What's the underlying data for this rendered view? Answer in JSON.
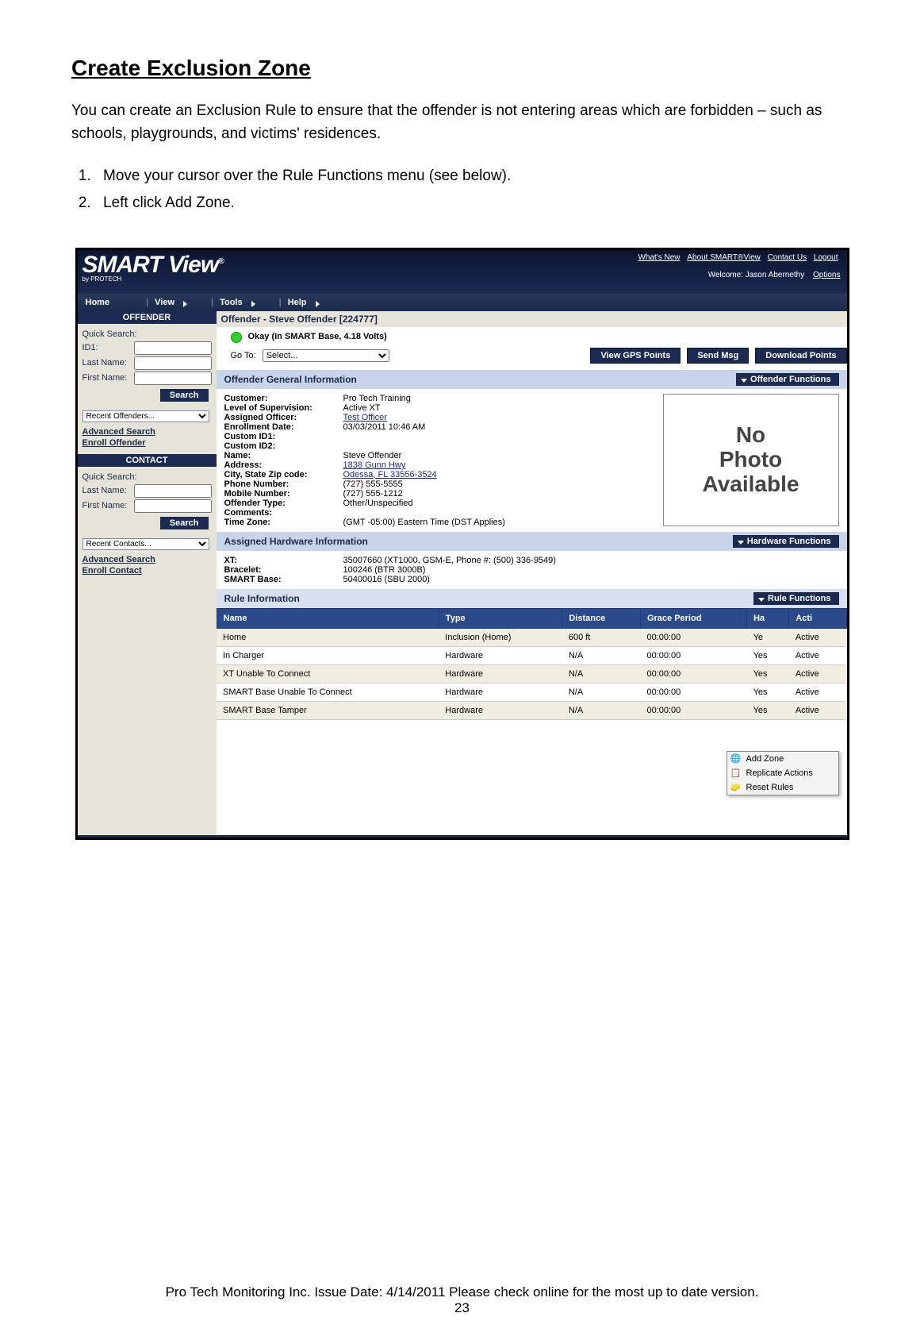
{
  "doc": {
    "heading": "Create Exclusion Zone",
    "intro": "You can create an Exclusion Rule to ensure that the offender is not entering areas which are forbidden – such as schools, playgrounds, and victims' residences.",
    "steps": [
      "Move your cursor over the Rule Functions menu (see below).",
      "Left click Add Zone."
    ],
    "footer_line1": "Pro Tech Monitoring Inc. Issue Date: 4/14/2011 Please check online for the most up to date version.",
    "footer_line2": "23"
  },
  "app": {
    "logo_main": "SMART View",
    "logo_sub": "by PROTECH",
    "toplinks": {
      "whats_new": "What's New",
      "about": "About SMART®View",
      "contact": "Contact Us",
      "logout": "Logout"
    },
    "welcome_prefix": "Welcome: ",
    "welcome_user": "Jason Abernethy",
    "options": "Options",
    "menu": {
      "home": "Home",
      "view": "View",
      "tools": "Tools",
      "help": "Help"
    }
  },
  "sidebar": {
    "offender_hdr": "OFFENDER",
    "quick_search": "Quick Search:",
    "id1": "ID1:",
    "last": "Last Name:",
    "first": "First Name:",
    "search_btn": "Search",
    "recent_off": "Recent Offenders...",
    "adv_search": "Advanced Search",
    "enroll_off": "Enroll Offender",
    "contact_hdr": "CONTACT",
    "recent_con": "Recent Contacts...",
    "enroll_con": "Enroll Contact"
  },
  "main": {
    "crumb": "Offender - Steve Offender [224777]",
    "status": "Okay (In SMART Base, 4.18 Volts)",
    "goto_label": "Go To:",
    "goto_value": "Select...",
    "btn_gps": "View GPS Points",
    "btn_msg": "Send Msg",
    "btn_dl": "Download Points",
    "sec_general": "Offender General Information",
    "fx_offender": "Offender Functions",
    "gen": {
      "labels": [
        "Customer:",
        "Level of Supervision:",
        "Assigned Officer:",
        "Enrollment Date:",
        "Custom ID1:",
        "Custom ID2:",
        "Name:",
        "Address:",
        "City, State Zip code:",
        "Phone Number:",
        "Mobile Number:",
        "Offender Type:",
        "Comments:",
        "Time Zone:"
      ],
      "values": [
        "Pro Tech Training",
        "Active XT",
        "Test Officer",
        "03/03/2011 10:46 AM",
        "",
        "",
        "Steve Offender",
        "1838 Gunn Hwy",
        "Odessa, FL 33556-3524",
        "(727) 555-5555",
        "(727) 555-1212",
        "Other/Unspecified",
        "",
        "(GMT -05:00) Eastern Time (DST Applies)"
      ]
    },
    "photo": "No\nPhoto\nAvailable",
    "sec_hw": "Assigned Hardware Information",
    "fx_hw": "Hardware Functions",
    "hw": {
      "labels": [
        "XT:",
        "Bracelet:",
        "SMART Base:"
      ],
      "values": [
        "35007660 (XT1000, GSM-E, Phone #: (500) 336-9549)",
        "100246 (BTR 3000B)",
        "50400016 (SBU 2000)"
      ]
    },
    "sec_rules": "Rule Information",
    "fx_rules": "Rule Functions",
    "rule_cols": {
      "name": "Name",
      "type": "Type",
      "dist": "Distance",
      "grace": "Grace Period",
      "hard": "Ha",
      "status": "Acti"
    },
    "rules": [
      {
        "name": "Home",
        "type": "Inclusion (Home)",
        "dist": "600 ft",
        "grace": "00:00:00",
        "hard": "Ye",
        "status": "Active"
      },
      {
        "name": "In Charger",
        "type": "Hardware",
        "dist": "N/A",
        "grace": "00:00:00",
        "hard": "Yes",
        "status": "Active"
      },
      {
        "name": "XT Unable To Connect",
        "type": "Hardware",
        "dist": "N/A",
        "grace": "00:00:00",
        "hard": "Yes",
        "status": "Active"
      },
      {
        "name": "SMART Base Unable To Connect",
        "type": "Hardware",
        "dist": "N/A",
        "grace": "00:00:00",
        "hard": "Yes",
        "status": "Active"
      },
      {
        "name": "SMART Base Tamper",
        "type": "Hardware",
        "dist": "N/A",
        "grace": "00:00:00",
        "hard": "Yes",
        "status": "Active"
      }
    ],
    "ctx": {
      "add": "Add Zone",
      "rep": "Replicate Actions",
      "reset": "Reset Rules"
    }
  }
}
